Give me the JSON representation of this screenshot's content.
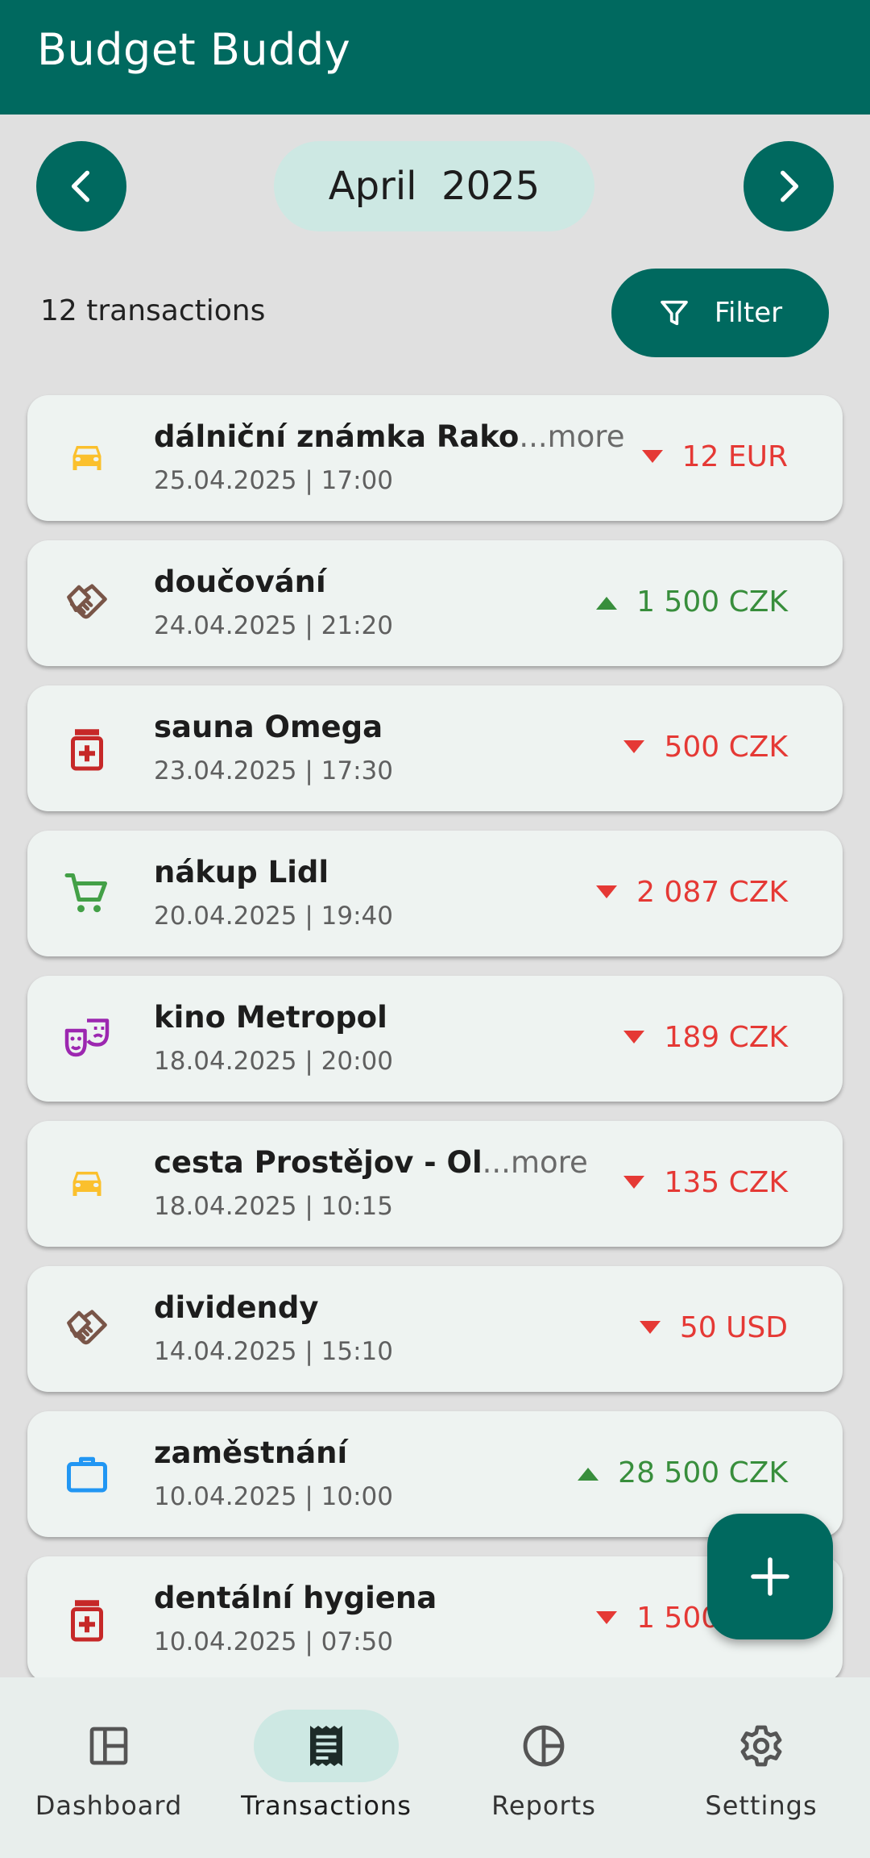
{
  "app": {
    "title": "Budget Buddy"
  },
  "month_nav": {
    "label": "April  2025"
  },
  "summary": {
    "count": "12 transactions",
    "filter_label": "Filter"
  },
  "transactions": [
    {
      "name": "dálniční známka Rako",
      "more": "...more",
      "date": "25.04.2025 | 17:00",
      "amount": "12 EUR",
      "direction": "down",
      "icon": "car-icon",
      "color": "#fbc02d"
    },
    {
      "name": "doučování",
      "more": "",
      "date": "24.04.2025 | 21:20",
      "amount": "1 500 CZK",
      "direction": "up",
      "icon": "handshake-icon",
      "color": "#795548"
    },
    {
      "name": "sauna Omega",
      "more": "",
      "date": "23.04.2025 | 17:30",
      "amount": "500 CZK",
      "direction": "down",
      "icon": "medicine-icon",
      "color": "#c62828"
    },
    {
      "name": "nákup Lidl",
      "more": "",
      "date": "20.04.2025 | 19:40",
      "amount": "2 087 CZK",
      "direction": "down",
      "icon": "cart-icon",
      "color": "#43a047"
    },
    {
      "name": "kino Metropol",
      "more": "",
      "date": "18.04.2025 | 20:00",
      "amount": "189 CZK",
      "direction": "down",
      "icon": "theater-icon",
      "color": "#9c27b0"
    },
    {
      "name": "cesta Prostějov - Ol",
      "more": "...more",
      "date": "18.04.2025 | 10:15",
      "amount": "135 CZK",
      "direction": "down",
      "icon": "car-icon",
      "color": "#fbc02d"
    },
    {
      "name": "dividendy",
      "more": "",
      "date": "14.04.2025 | 15:10",
      "amount": "50 USD",
      "direction": "down",
      "icon": "handshake-icon",
      "color": "#795548"
    },
    {
      "name": "zaměstnání",
      "more": "",
      "date": "10.04.2025 | 10:00",
      "amount": "28 500 CZK",
      "direction": "up",
      "icon": "briefcase-icon",
      "color": "#2196f3"
    },
    {
      "name": "dentální hygiena",
      "more": "",
      "date": "10.04.2025 | 07:50",
      "amount": "1 500 CZK",
      "direction": "down",
      "icon": "medicine-icon",
      "color": "#c62828"
    }
  ],
  "bottom_nav": [
    {
      "label": "Dashboard",
      "icon": "dashboard-icon",
      "active": false
    },
    {
      "label": "Transactions",
      "icon": "receipt-icon",
      "active": true
    },
    {
      "label": "Reports",
      "icon": "pie-chart-icon",
      "active": false
    },
    {
      "label": "Settings",
      "icon": "gear-icon",
      "active": false
    }
  ],
  "colors": {
    "primary": "#00695f",
    "accent_light": "#cde8e3",
    "negative": "#e53935",
    "positive": "#388e3c"
  }
}
